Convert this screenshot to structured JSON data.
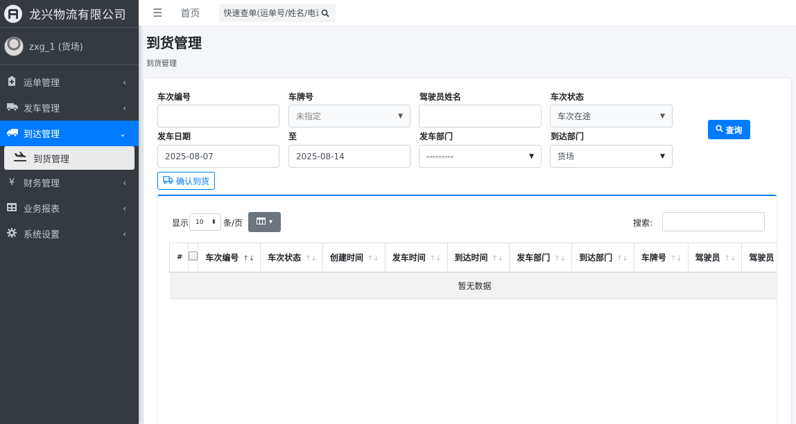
{
  "brand": {
    "name": "龙兴物流有限公司"
  },
  "user": {
    "name": "zxg_1 (货场)"
  },
  "sidebar": {
    "items": [
      {
        "label": "运单管理",
        "icon": "clipboard-icon"
      },
      {
        "label": "发车管理",
        "icon": "truck-icon"
      },
      {
        "label": "到达管理",
        "icon": "truck-arrive-icon",
        "active": true
      },
      {
        "label": "到货管理",
        "icon": "plane-landing-icon",
        "sub": true
      },
      {
        "label": "财务管理",
        "icon": "yen-icon"
      },
      {
        "label": "业务报表",
        "icon": "table-icon"
      },
      {
        "label": "系统设置",
        "icon": "gear-icon"
      }
    ]
  },
  "navbar": {
    "home": "首页",
    "search_placeholder": "快速查单(运单号/姓名/电话"
  },
  "header": {
    "title": "到货管理",
    "breadcrumb": "到货管理"
  },
  "filters": {
    "trip_no_label": "车次编号",
    "trip_no_value": "",
    "plate_label": "车牌号",
    "plate_value": "未指定",
    "driver_label": "驾驶员姓名",
    "driver_value": "",
    "status_label": "车次状态",
    "status_value": "车次在途",
    "depart_date_label": "发车日期",
    "depart_date_from": "2025-08-07",
    "to_label": "至",
    "depart_date_to": "2025-08-14",
    "depart_dept_label": "发车部门",
    "depart_dept_value": "---------",
    "arrive_dept_label": "到达部门",
    "arrive_dept_value": "货场",
    "query_button": "查询",
    "confirm_button": "确认到货"
  },
  "table": {
    "show_label": "显示",
    "page_size": "10",
    "per_page_label": "条/页",
    "search_label": "搜索:",
    "columns": [
      "#",
      "",
      "车次编号",
      "车次状态",
      "创建时间",
      "发车时间",
      "到达时间",
      "发车部门",
      "到达部门",
      "车牌号",
      "驾驶员",
      "驾驶员"
    ],
    "empty_text": "暂无数据"
  },
  "colors": {
    "primary": "#007bff",
    "sidebar": "#343a40",
    "secondary": "#6c757d"
  }
}
